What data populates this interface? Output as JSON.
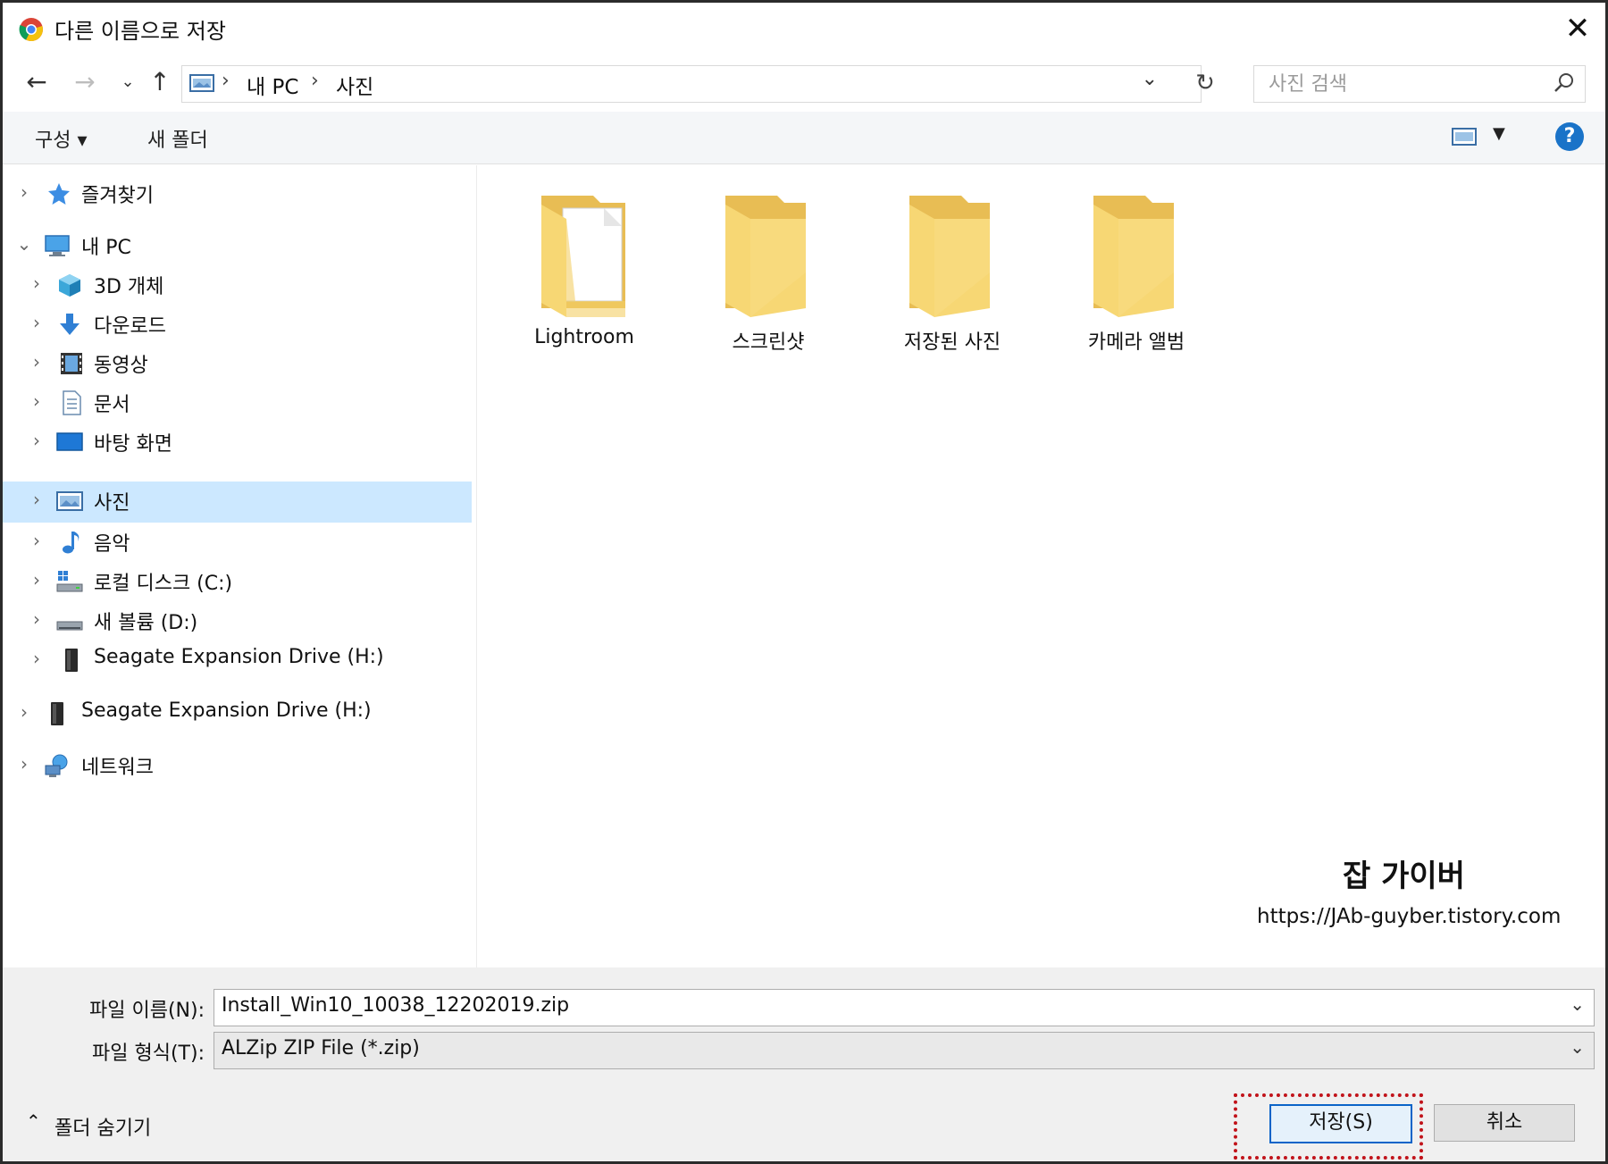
{
  "window": {
    "title": "다른 이름으로 저장",
    "close_glyph": "✕"
  },
  "address": {
    "crumbs": [
      "내 PC",
      "사진"
    ],
    "search_placeholder": "사진 검색"
  },
  "toolbar": {
    "organize_label": "구성 ▾",
    "new_folder_label": "새 폴더",
    "help_label": "?"
  },
  "nav_tree": [
    {
      "label": "즐겨찾기",
      "icon": "star-icon",
      "level": 0
    },
    {
      "label": "내 PC",
      "icon": "pc-icon",
      "level": 0,
      "expanded": true
    },
    {
      "label": "3D 개체",
      "icon": "3d-objects-icon",
      "level": 1
    },
    {
      "label": "다운로드",
      "icon": "download-icon",
      "level": 1
    },
    {
      "label": "동영상",
      "icon": "video-icon",
      "level": 1
    },
    {
      "label": "문서",
      "icon": "document-icon",
      "level": 1
    },
    {
      "label": "바탕 화면",
      "icon": "desktop-icon",
      "level": 1
    },
    {
      "label": "사진",
      "icon": "pictures-icon",
      "level": 1,
      "selected": true
    },
    {
      "label": "음악",
      "icon": "music-icon",
      "level": 1
    },
    {
      "label": "로컬 디스크 (C:)",
      "icon": "local-disk-icon",
      "level": 1
    },
    {
      "label": "새 볼륨 (D:)",
      "icon": "drive-icon",
      "level": 1
    },
    {
      "label": "Seagate Expansion Drive (H:)",
      "icon": "external-drive-icon",
      "level": 1
    },
    {
      "label": "Seagate Expansion Drive (H:)",
      "icon": "external-drive-icon",
      "level": 0
    },
    {
      "label": "네트워크",
      "icon": "network-icon",
      "level": 0
    }
  ],
  "folders": [
    {
      "label": "Lightroom",
      "has_doc": true
    },
    {
      "label": "스크린샷"
    },
    {
      "label": "저장된 사진"
    },
    {
      "label": "카메라 앨범"
    }
  ],
  "watermark": {
    "title": "잡 가이버",
    "url": "https://JAb-guyber.tistory.com"
  },
  "bottom": {
    "filename_label": "파일 이름(N):",
    "filename_value": "Install_Win10_10038_12202019.zip",
    "filetype_label": "파일 형식(T):",
    "filetype_value": "ALZip ZIP File (*.zip)",
    "hide_folders_label": "폴더 숨기기",
    "save_label": "저장(S)",
    "cancel_label": "취소"
  },
  "colors": {
    "accent": "#1a73c8",
    "selection": "#cce8ff",
    "folder": "#f7d774",
    "highlight_outline": "#c1131a"
  }
}
